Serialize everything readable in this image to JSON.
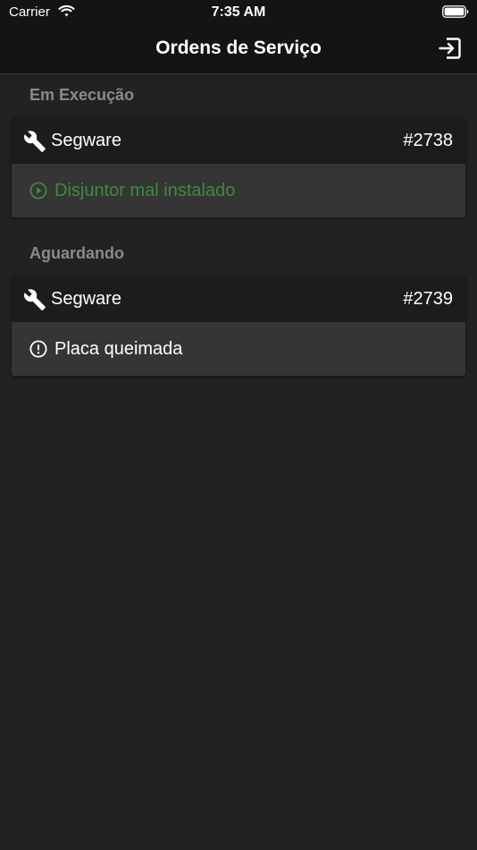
{
  "status_bar": {
    "carrier": "Carrier",
    "time": "7:35 AM",
    "icons": [
      "wifi-icon",
      "battery-icon"
    ]
  },
  "nav": {
    "title": "Ordens de Serviço",
    "logout_icon": "logout-icon"
  },
  "sections": [
    {
      "title": "Em Execução",
      "orders": [
        {
          "client": "Segware",
          "number": "#2738",
          "description": "Disjuntor mal instalado",
          "status_icon": "play-circle-icon",
          "status_color": "#3f8a3f"
        }
      ]
    },
    {
      "title": "Aguardando",
      "orders": [
        {
          "client": "Segware",
          "number": "#2739",
          "description": "Placa queimada",
          "status_icon": "alert-circle-icon",
          "status_color": "#ffffff"
        }
      ]
    }
  ],
  "colors": {
    "background": "#222222",
    "bar": "#141414",
    "card_head": "#1c1c1c",
    "card_body": "#353535",
    "section_header": "#8a8a8a",
    "running": "#3f8a3f"
  }
}
